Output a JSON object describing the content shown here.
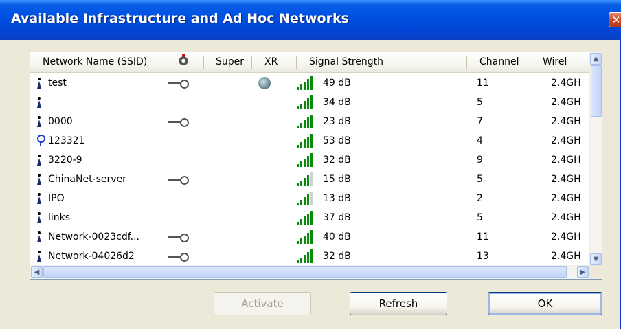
{
  "window": {
    "title": "Available Infrastructure and Ad Hoc Networks",
    "close_glyph": "✕"
  },
  "columns": {
    "name": "Network Name (SSID)",
    "encryption_icon": "lock-key-icon",
    "super": "Super",
    "xr": "XR",
    "signal": "Signal Strength",
    "channel": "Channel",
    "wireless": "Wirel"
  },
  "rows": [
    {
      "type": "station",
      "name": "test",
      "encrypted": true,
      "xr": true,
      "signal_bars": 5,
      "signal": "49 dB",
      "channel": "11",
      "wireless": "2.4GH"
    },
    {
      "type": "station",
      "name": "",
      "encrypted": false,
      "xr": false,
      "signal_bars": 5,
      "signal": "34 dB",
      "channel": "5",
      "wireless": "2.4GH"
    },
    {
      "type": "station",
      "name": "0000",
      "encrypted": true,
      "xr": false,
      "signal_bars": 5,
      "signal": "23 dB",
      "channel": "7",
      "wireless": "2.4GH"
    },
    {
      "type": "ap",
      "name": "123321",
      "encrypted": false,
      "xr": false,
      "signal_bars": 5,
      "signal": "53 dB",
      "channel": "4",
      "wireless": "2.4GH"
    },
    {
      "type": "station",
      "name": "3220-9",
      "encrypted": false,
      "xr": false,
      "signal_bars": 5,
      "signal": "32 dB",
      "channel": "9",
      "wireless": "2.4GH"
    },
    {
      "type": "station",
      "name": "ChinaNet-server",
      "encrypted": true,
      "xr": false,
      "signal_bars": 4,
      "signal": "15 dB",
      "channel": "5",
      "wireless": "2.4GH"
    },
    {
      "type": "station",
      "name": "IPO",
      "encrypted": false,
      "xr": false,
      "signal_bars": 4,
      "signal": "13 dB",
      "channel": "2",
      "wireless": "2.4GH"
    },
    {
      "type": "station",
      "name": "links",
      "encrypted": false,
      "xr": false,
      "signal_bars": 5,
      "signal": "37 dB",
      "channel": "5",
      "wireless": "2.4GH"
    },
    {
      "type": "station",
      "name": "Network-0023cdf...",
      "encrypted": true,
      "xr": false,
      "signal_bars": 5,
      "signal": "40 dB",
      "channel": "11",
      "wireless": "2.4GH"
    },
    {
      "type": "station",
      "name": "Network-04026d2",
      "encrypted": true,
      "xr": false,
      "signal_bars": 5,
      "signal": "32 dB",
      "channel": "13",
      "wireless": "2.4GH"
    }
  ],
  "buttons": {
    "activate_mnemonic": "A",
    "activate_rest": "ctivate",
    "refresh": "Refresh",
    "ok": "OK"
  },
  "scroll": {
    "up": "▲",
    "down": "▼",
    "left": "◀",
    "right": "▶"
  },
  "colors": {
    "titlebar": "#0055e5",
    "signal_on": "#0a8a0a",
    "signal_off": "#d0d0d0"
  }
}
